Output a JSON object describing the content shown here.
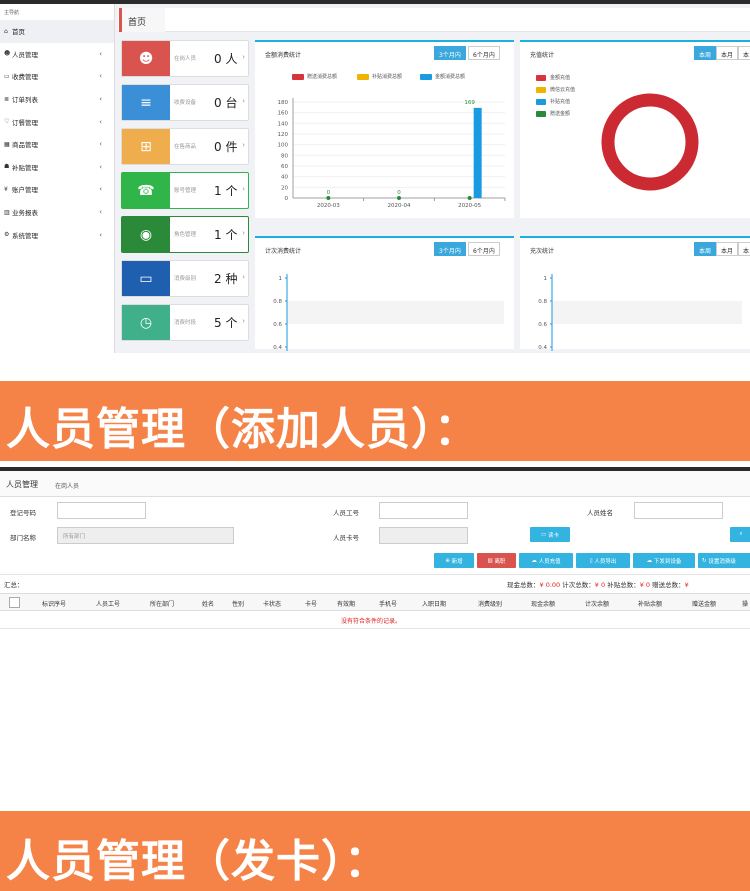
{
  "dashboard": {
    "sidebar": {
      "header": "主导航",
      "items": [
        {
          "icon": "home-icon",
          "glyph": "⌂",
          "label": "首页"
        },
        {
          "icon": "people-icon",
          "glyph": "☻",
          "label": "人员管理"
        },
        {
          "icon": "card-icon",
          "glyph": "▭",
          "label": "收费管理"
        },
        {
          "icon": "list-icon",
          "glyph": "≣",
          "label": "订单列表"
        },
        {
          "icon": "heart-icon",
          "glyph": "♡",
          "label": "订餐管理"
        },
        {
          "icon": "store-icon",
          "glyph": "▦",
          "label": "商品管理"
        },
        {
          "icon": "subsidy-icon",
          "glyph": "☗",
          "label": "补贴管理"
        },
        {
          "icon": "yen-icon",
          "glyph": "¥",
          "label": "账户管理"
        },
        {
          "icon": "report-icon",
          "glyph": "▥",
          "label": "业务报表"
        },
        {
          "icon": "gear-icon",
          "glyph": "⚙",
          "label": "系统管理"
        }
      ]
    },
    "tab_home": "首页",
    "stats": [
      {
        "label": "在岗人员",
        "value": "0 人",
        "color": "#d9534f",
        "icon": "people-icon",
        "glyph": "☻"
      },
      {
        "label": "收费设备",
        "value": "0 台",
        "color": "#3a8fd6",
        "icon": "server-icon",
        "glyph": "≡"
      },
      {
        "label": "在售商品",
        "value": "0 件",
        "color": "#f0ad4e",
        "icon": "basket-icon",
        "glyph": "⊞"
      },
      {
        "label": "账号管理",
        "value": "1 个",
        "color": "#2fb54a",
        "icon": "contact-icon",
        "glyph": "☎"
      },
      {
        "label": "角色管理",
        "value": "1 个",
        "color": "#2a8a3a",
        "icon": "user-circle-icon",
        "glyph": "◉"
      },
      {
        "label": "消费级别",
        "value": "2 种",
        "color": "#1f5fb0",
        "icon": "card-icon",
        "glyph": "▭"
      },
      {
        "label": "消费时段",
        "value": "5 个",
        "color": "#3fb08a",
        "icon": "clock-icon",
        "glyph": "◷"
      }
    ],
    "panels": {
      "amount": {
        "title": "金额消费统计",
        "btn1": "3个月内",
        "btn2": "6个月内",
        "legend": [
          "赠送消费总额",
          "补贴消费总额",
          "金额消费总额"
        ]
      },
      "recharge": {
        "title": "充值统计",
        "btn1": "本周",
        "btn2": "本月",
        "btn3": "本"
      },
      "count": {
        "title": "计次消费统计",
        "btn1": "3个月内",
        "btn2": "6个月内"
      },
      "recharge_count": {
        "title": "充次统计",
        "btn1": "本周",
        "btn2": "本月",
        "btn3": "本"
      }
    }
  },
  "colors": {
    "gift": "#d9343b",
    "subsidy": "#f0b400",
    "cash": "#1a9ae0",
    "donut": "#cc2a33",
    "accent": "#3aa8dd"
  },
  "chart_data": [
    {
      "type": "bar",
      "title": "金额消费统计",
      "categories": [
        "2020-03",
        "2020-04",
        "2020-05"
      ],
      "series": [
        {
          "name": "赠送消费总额",
          "values": [
            0,
            0,
            0
          ]
        },
        {
          "name": "补贴消费总额",
          "values": [
            0,
            0,
            0
          ]
        },
        {
          "name": "金额消费总额",
          "values": [
            0,
            0,
            169
          ]
        }
      ],
      "data_labels": [
        "0",
        "0",
        "169"
      ],
      "yticks": [
        "0",
        "20",
        "40",
        "60",
        "80",
        "100",
        "120",
        "140",
        "160",
        "180"
      ],
      "ylim": [
        0,
        180
      ]
    },
    {
      "type": "pie",
      "title": "充值统计",
      "legend": [
        "金额充值",
        "微信云充值",
        "补贴充值",
        "赠送金额"
      ],
      "legend_colors": [
        "#d9343b",
        "#f0b400",
        "#1a9ae0",
        "#2a8a3a"
      ]
    },
    {
      "type": "line",
      "title": "计次消费统计",
      "yticks": [
        "1",
        "0.8",
        "0.6",
        "0.4"
      ]
    },
    {
      "type": "line",
      "title": "充次统计",
      "yticks": [
        "1",
        "0.8",
        "0.6",
        "0.4"
      ]
    }
  ],
  "banner1": "人员管理（添加人员）：",
  "banner2": "人员管理（发卡）：",
  "people": {
    "title": "人员管理",
    "subtitle": "在岗人员",
    "fields": {
      "reg_no": "登记号码",
      "emp_no": "人员工号",
      "name": "人员姓名",
      "dept": "部门名称",
      "dept_value": "所有部门",
      "card_no": "人员卡号",
      "read_card": "读卡"
    },
    "actions": [
      "新增",
      "离职",
      "人员充值",
      "人员导出",
      "下发到设备",
      "设置消费级"
    ],
    "summary": {
      "label": "汇总：",
      "cash_label": "现金总数：",
      "cash": "¥ 0.00",
      "count_label": "计次总数：",
      "count": "¥ 0",
      "subsidy_label": "补贴总数：",
      "subsidy": "¥ 0",
      "gift_label": "赠送总数：",
      "gift": "¥"
    },
    "columns": [
      "标识序号",
      "人员工号",
      "所在部门",
      "姓名",
      "性别",
      "卡状态",
      "卡号",
      "有效期",
      "手机号",
      "入职日期",
      "消费级别",
      "现金余额",
      "计次余额",
      "补贴余额",
      "赠送金额",
      "操"
    ],
    "empty": "没有符合条件的记录。"
  }
}
